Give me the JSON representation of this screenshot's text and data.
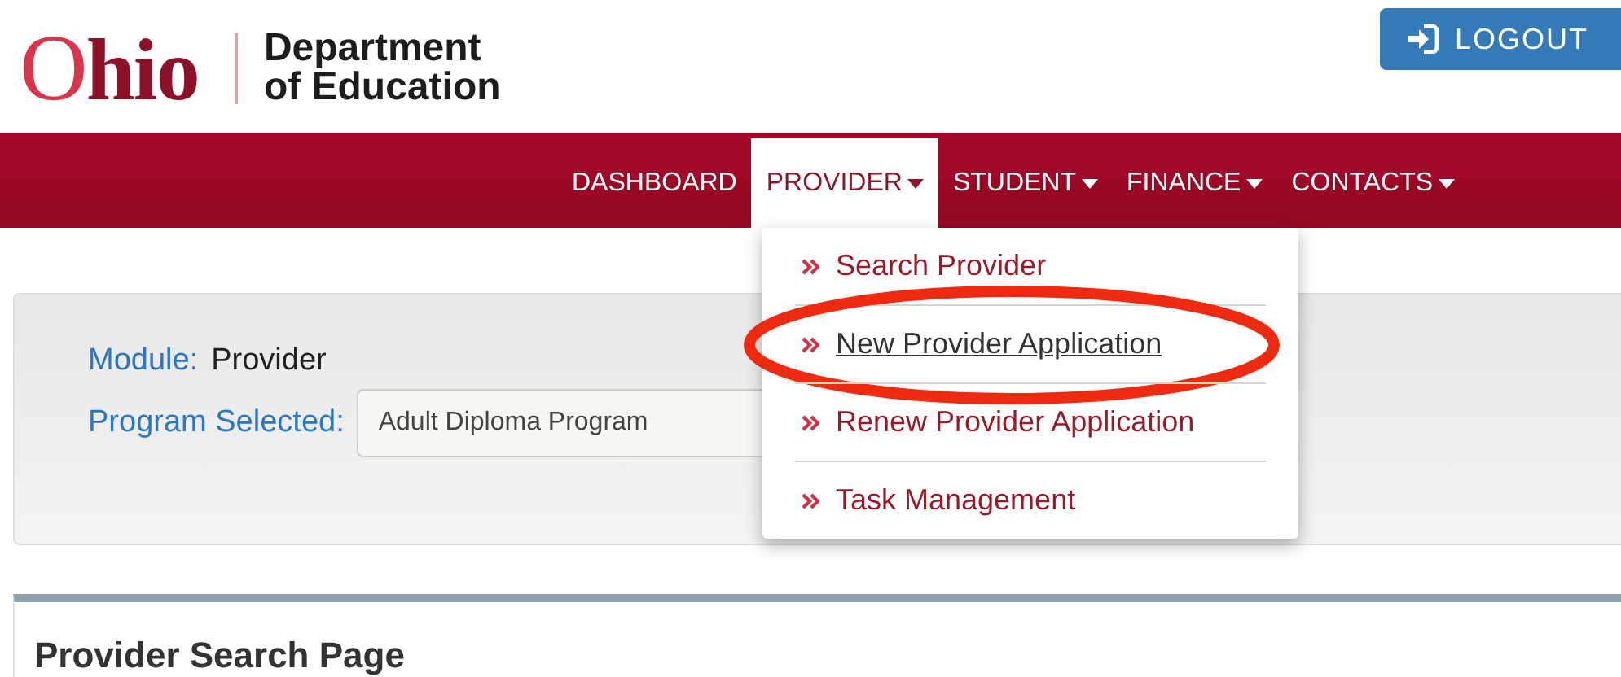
{
  "logo": {
    "wordmark": "Ohio",
    "department_line1": "Department",
    "department_line2": "of Education"
  },
  "logout_button": {
    "label": "LOGOUT"
  },
  "nav": [
    {
      "label": "DASHBOARD",
      "dropdown": false,
      "selected": false
    },
    {
      "label": "PROVIDER",
      "dropdown": true,
      "selected": true
    },
    {
      "label": "STUDENT",
      "dropdown": true,
      "selected": false
    },
    {
      "label": "FINANCE",
      "dropdown": true,
      "selected": false
    },
    {
      "label": "CONTACTS",
      "dropdown": true,
      "selected": false
    }
  ],
  "dropdown_menu": [
    {
      "label": "Search Provider",
      "highlighted": false
    },
    {
      "label": "New Provider Application",
      "highlighted": true
    },
    {
      "label": "Renew Provider Application",
      "highlighted": false
    },
    {
      "label": "Task Management",
      "highlighted": false
    }
  ],
  "module_panel": {
    "module_label": "Module:",
    "module_value": "Provider",
    "program_label": "Program Selected:",
    "program_value": "Adult Diploma Program"
  },
  "search_panel": {
    "title": "Provider Search Page"
  }
}
